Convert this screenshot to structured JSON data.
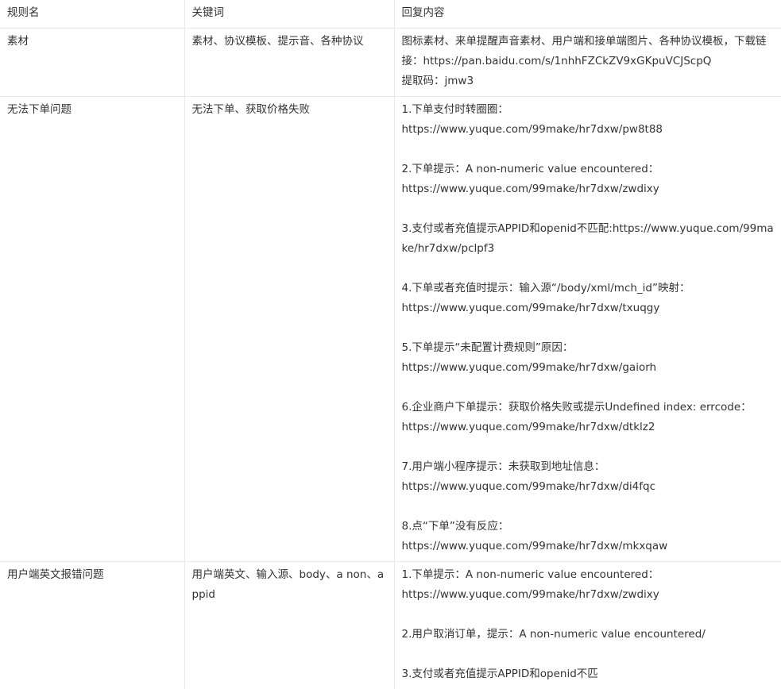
{
  "table": {
    "headers": [
      "规则名",
      "关键词",
      "回复内容"
    ],
    "rows": [
      {
        "name": "素材",
        "keywords": "素材、协议模板、提示音、各种协议",
        "reply": [
          [
            "图标素材、来单提醒声音素材、用户端和接单端图片、各种协议模板，下载链接：https://pan.baidu.com/s/1nhhFZCkZV9xGKpuVCJScpQ",
            "提取码：jmw3"
          ]
        ]
      },
      {
        "name": "无法下单问题",
        "keywords": "无法下单、获取价格失败",
        "reply": [
          [
            "1.下单支付时转圈圈：",
            "https://www.yuque.com/99make/hr7dxw/pw8t88"
          ],
          [
            "2.下单提示：A non-numeric value encountered：",
            "https://www.yuque.com/99make/hr7dxw/zwdixy"
          ],
          [
            "3.支付或者充值提示APPID和openid不匹配:https://www.yuque.com/99make/hr7dxw/pclpf3"
          ],
          [
            "4.下单或者充值时提示：输入源“/body/xml/mch_id”映射：",
            "https://www.yuque.com/99make/hr7dxw/txuqgy"
          ],
          [
            "5.下单提示“未配置计费规则”原因：",
            "https://www.yuque.com/99make/hr7dxw/gaiorh"
          ],
          [
            "6.企业商户下单提示：获取价格失败或提示Undefined index: errcode：",
            "https://www.yuque.com/99make/hr7dxw/dtklz2"
          ],
          [
            "7.用户端小程序提示：未获取到地址信息：",
            "https://www.yuque.com/99make/hr7dxw/di4fqc"
          ],
          [
            "8.点“下单”没有反应：",
            "https://www.yuque.com/99make/hr7dxw/mkxqaw"
          ]
        ]
      },
      {
        "name": "用户端英文报错问题",
        "keywords": "用户端英文、输入源、body、a non、appid",
        "reply": [
          [
            "1.下单提示：A non-numeric value encountered：",
            "https://www.yuque.com/99make/hr7dxw/zwdixy"
          ],
          [
            "2.用户取消订单，提示：A non-numeric value encountered/"
          ],
          [
            "3.支付或者充值提示APPID和openid不匹"
          ]
        ]
      }
    ]
  }
}
